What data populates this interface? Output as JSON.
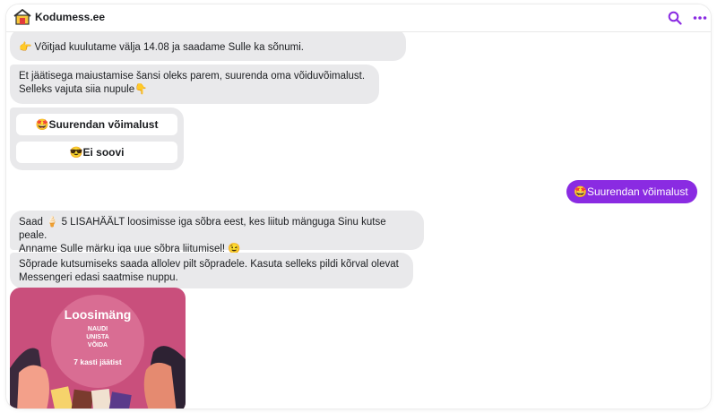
{
  "app": {
    "title": "Kodumess.ee"
  },
  "header": {
    "search_icon": "search-icon",
    "more_icon": "more-icon"
  },
  "messages": {
    "m1": {
      "emoji": "👉",
      "text": "Võitjad kuulutame välja 14.08 ja saadame Sulle ka sõnumi."
    },
    "m2": {
      "line1": "Et jäätisega maiustamise šansi oleks parem, suurenda oma võiduvõimalust.",
      "line2": "Selleks vajuta siia nupule",
      "emoji": "👇"
    },
    "buttons": [
      {
        "emoji": "🤩",
        "label": "Suurendan võimalust"
      },
      {
        "emoji": "😎",
        "label": "Ei soovi"
      }
    ],
    "outgoing": {
      "emoji": "🤩",
      "label": "Suurendan võimalust"
    },
    "m3": {
      "line1a": "Saad ",
      "emoji1": "🍦",
      "line1b": " 5 LISAHÄÄLT loosimisse iga sõbra eest, kes liitub mänguga Sinu kutse peale.",
      "line2": "Anname Sulle märku iga uue sõbra liitumisel! ",
      "emoji2": "😉"
    },
    "m4": {
      "line1": "Sõprade kutsumiseks saada allolev pilt sõpradele. Kasuta selleks pildi kõrval olevat",
      "line2": "Messengeri edasi saatmise nuppu."
    }
  },
  "image": {
    "title": "Loosimäng",
    "line1": "NAUDI",
    "line2": "UNISTA",
    "line3": "VÕIDA",
    "prize": "7 kasti jäätist"
  },
  "colors": {
    "accent": "#8a2be2",
    "bubble": "#e9e9eb"
  }
}
